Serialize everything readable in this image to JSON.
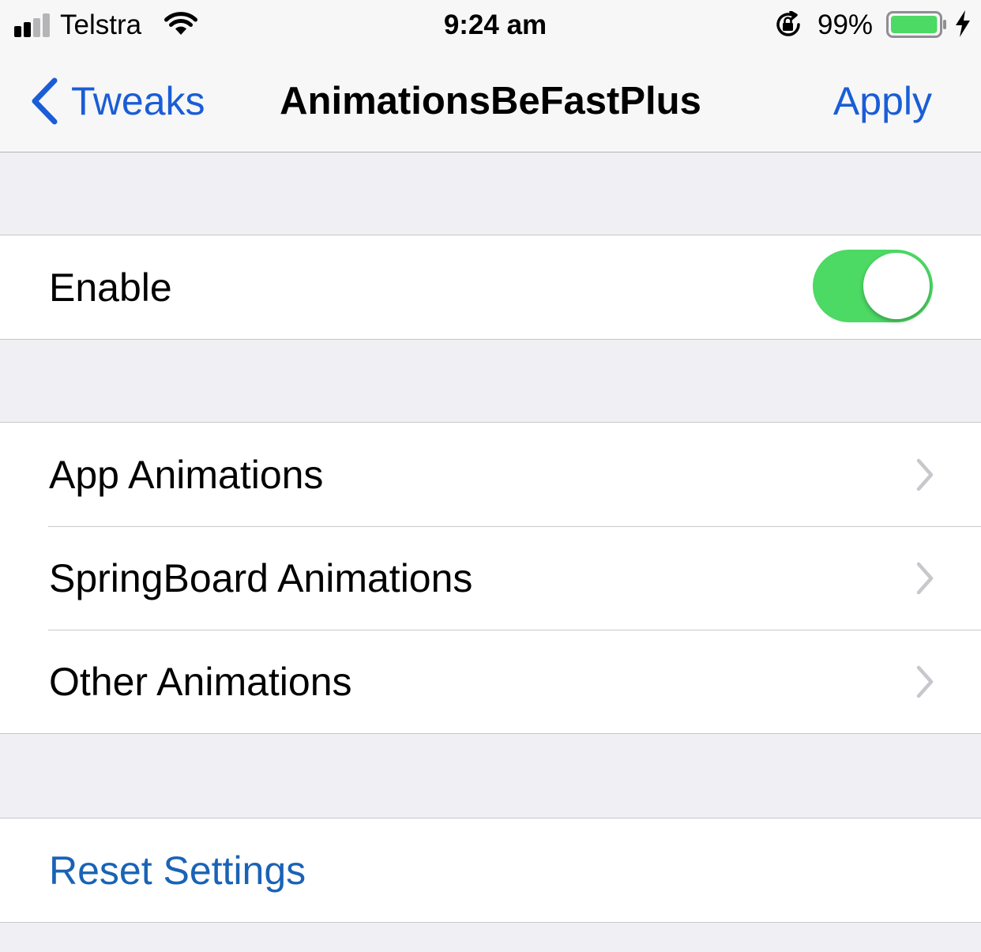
{
  "status_bar": {
    "carrier": "Telstra",
    "time": "9:24 am",
    "battery_percent": "99%",
    "signal_bars_filled": 2,
    "signal_bars_total": 4,
    "battery_level": 0.99,
    "icons": [
      "signal-icon",
      "wifi-icon",
      "rotation-lock-icon",
      "battery-icon",
      "charging-bolt-icon"
    ]
  },
  "nav": {
    "back_label": "Tweaks",
    "title": "AnimationsBeFastPlus",
    "apply_label": "Apply"
  },
  "enable_group": {
    "label": "Enable",
    "enabled": true
  },
  "animations_group": {
    "items": [
      {
        "label": "App Animations"
      },
      {
        "label": "SpringBoard Animations"
      },
      {
        "label": "Other Animations"
      }
    ]
  },
  "reset_group": {
    "label": "Reset Settings"
  },
  "colors": {
    "tint": "#1a5dd6",
    "link": "#1a63b5",
    "toggle_on": "#4cd964",
    "battery_fill": "#4cd964",
    "background": "#efeff4",
    "chevron": "#c7c7cc"
  }
}
